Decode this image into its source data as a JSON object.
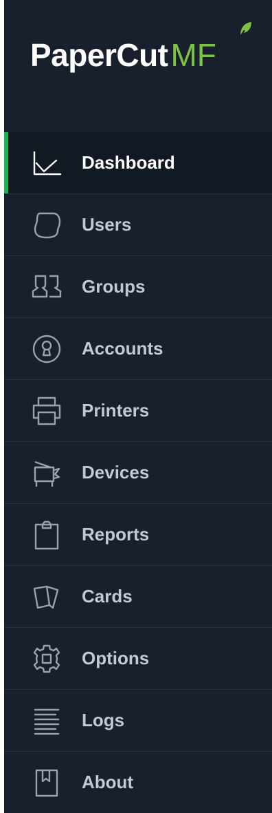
{
  "logo": {
    "main": "PaperCut",
    "accent": "MF"
  },
  "colors": {
    "sidebar_bg": "#17202c",
    "active_bg": "#111923",
    "active_indicator": "#1fb25a",
    "logo_accent": "#7dc242",
    "icon_color": "#9aa3ad"
  },
  "nav": {
    "active": "Dashboard",
    "items": [
      {
        "label": "Dashboard",
        "icon": "chart-line-icon"
      },
      {
        "label": "Users",
        "icon": "user-head-icon"
      },
      {
        "label": "Groups",
        "icon": "group-icon"
      },
      {
        "label": "Accounts",
        "icon": "keyhole-icon"
      },
      {
        "label": "Printers",
        "icon": "printer-icon"
      },
      {
        "label": "Devices",
        "icon": "device-icon"
      },
      {
        "label": "Reports",
        "icon": "clipboard-icon"
      },
      {
        "label": "Cards",
        "icon": "cards-icon"
      },
      {
        "label": "Options",
        "icon": "gear-icon"
      },
      {
        "label": "Logs",
        "icon": "lines-icon"
      },
      {
        "label": "About",
        "icon": "book-icon"
      }
    ]
  }
}
